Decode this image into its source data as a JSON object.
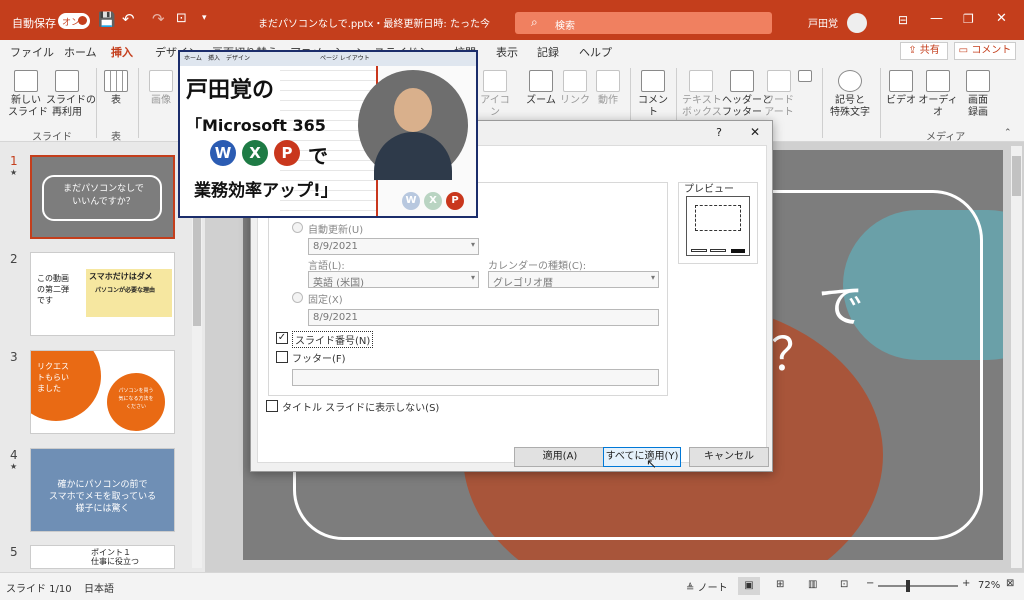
{
  "title_bar": {
    "autosave_label": "自動保存",
    "autosave_state": "オン",
    "document_title": "まだパソコンなしで.pptx・最終更新日時: たった今",
    "search_placeholder": "検索",
    "user_name": "戸田覚"
  },
  "ribbon_tabs": [
    "ファイル",
    "ホーム",
    "挿入",
    "デザイン",
    "画面切り替え",
    "アニメーション",
    "スライドショー",
    "校閲",
    "表示",
    "記録",
    "ヘルプ"
  ],
  "active_tab": "挿入",
  "share_label": "共有",
  "comment_label": "コメント",
  "ribbon": {
    "new_slide": "新しい\nスライド",
    "reuse_slide": "スライドの\n再利用",
    "slides_group": "スライド",
    "table": "表",
    "table_group": "表",
    "images": "画像",
    "icons": "アイコ\nン",
    "zoom": "ズーム",
    "link": "リンク",
    "action": "動作",
    "comment": "コメント",
    "textbox": "テキスト\nボックス",
    "header_footer": "ヘッダーと\nフッター",
    "wordart": "ワード\nアート",
    "symbols": "記号と\n特殊文字",
    "video": "ビデオ",
    "audio": "オーディオ",
    "screen_record": "画面\n録画",
    "media_group": "メディア"
  },
  "slides": [
    {
      "num": "1",
      "text": "まだパソコンなしで\nいいんですか？"
    },
    {
      "num": "2",
      "text_a": "この動画\nの第二弾\nです",
      "text_b": "スマホだけはダメ",
      "text_c": "パソコンが必要な理由"
    },
    {
      "num": "3",
      "text_a": "リクエス\nトもらい\nました",
      "text_b": "パソコンを買う\n気になる方法を\nください"
    },
    {
      "num": "4",
      "text": "確かにパソコンの前で\nスマホでメモを取っている\n様子には驚く"
    },
    {
      "num": "5",
      "text": "ポイント１\n仕事に役立つ"
    }
  ],
  "dialog": {
    "help": "?",
    "close": "✕",
    "auto_update": "自動更新(U)",
    "date_value": "8/9/2021",
    "language_label": "言語(L):",
    "language_value": "英語 (米国)",
    "calendar_label": "カレンダーの種類(C):",
    "calendar_value": "グレゴリオ暦",
    "fixed": "固定(X)",
    "fixed_value": "8/9/2021",
    "slide_number": "スライド番号(N)",
    "footer": "フッター(F)",
    "no_title_slide": "タイトル スライドに表示しない(S)",
    "preview": "プレビュー",
    "apply": "適用(A)",
    "apply_all": "すべてに適用(Y)",
    "cancel": "キャンセル"
  },
  "promo": {
    "line1": "戸田覚の",
    "line2": "「Microsoft 365",
    "line3": "で",
    "line4": "業務効率アップ!」",
    "badge_w": "W",
    "badge_x": "X",
    "badge_p": "P",
    "mini_tab_home": "ホーム",
    "mini_tab_insert": "挿入",
    "mini_tab_design": "デザイン",
    "mini_tab_layout": "ページ レイアウト"
  },
  "slide_text": {
    "ch1": "で",
    "ch2": "？"
  },
  "status": {
    "slide_info": "スライド 1/10",
    "language": "日本語",
    "notes": "ノート",
    "zoom": "72%"
  },
  "colors": {
    "titlebar": "#c43e1c",
    "accent_orange": "#e96a14",
    "word_blue": "#2b5cb3",
    "excel_green": "#1e7b45",
    "ppt_red": "#c9371d"
  }
}
